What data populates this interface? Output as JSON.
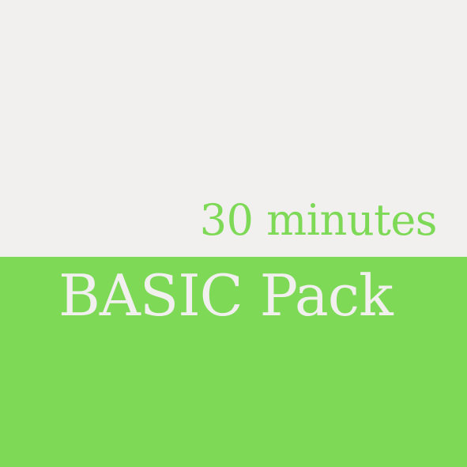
{
  "card": {
    "duration": "30 minutes",
    "title": "BASIC Pack"
  },
  "colors": {
    "background_light": "#F1F0EE",
    "accent_green": "#7ED957"
  }
}
